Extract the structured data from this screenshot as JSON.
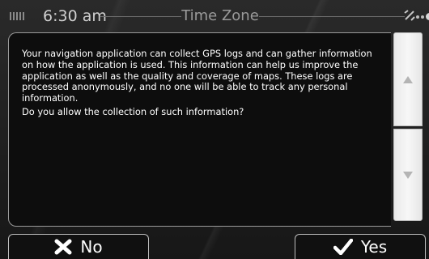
{
  "status_bar": {
    "time": "6:30 am",
    "title": "Time Zone"
  },
  "dialog": {
    "message": "Your navigation application can collect GPS logs and can gather information on how the application is used. This information can help us improve the application as well as the quality and coverage of maps. These logs are processed anonymously, and no one will be able to track any personal information.",
    "question": "Do you allow the collection of such information?"
  },
  "buttons": {
    "no_label": "No",
    "yes_label": "Yes"
  },
  "icons": {
    "signal": "signal-strength-icon",
    "gps": "satellite-icon",
    "menu": "more-dots-icon",
    "scroll_up": "arrow-up-icon",
    "scroll_down": "arrow-down-icon",
    "no": "x-mark-icon",
    "yes": "checkmark-icon"
  }
}
